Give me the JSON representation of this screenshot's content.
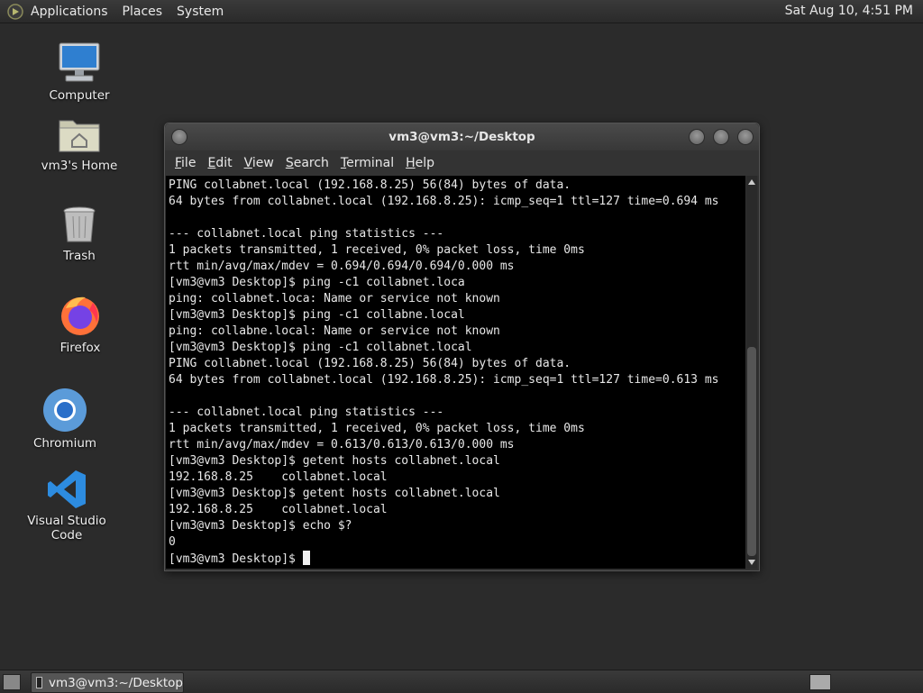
{
  "top_panel": {
    "menus": [
      "Applications",
      "Places",
      "System"
    ],
    "clock": "Sat Aug 10,  4:51 PM"
  },
  "desktop_icons": [
    {
      "label": "Computer",
      "icon": "computer-icon"
    },
    {
      "label": "vm3's Home",
      "icon": "home-folder-icon"
    },
    {
      "label": "Trash",
      "icon": "trash-icon"
    },
    {
      "label": "Firefox",
      "icon": "firefox-icon"
    },
    {
      "label": "Chromium",
      "icon": "chromium-icon"
    },
    {
      "label": "Visual Studio Code",
      "icon": "vscode-icon"
    }
  ],
  "terminal": {
    "title": "vm3@vm3:~/Desktop",
    "menu": [
      "File",
      "Edit",
      "View",
      "Search",
      "Terminal",
      "Help"
    ],
    "lines": [
      "PING collabnet.local (192.168.8.25) 56(84) bytes of data.",
      "64 bytes from collabnet.local (192.168.8.25): icmp_seq=1 ttl=127 time=0.694 ms",
      "",
      "--- collabnet.local ping statistics ---",
      "1 packets transmitted, 1 received, 0% packet loss, time 0ms",
      "rtt min/avg/max/mdev = 0.694/0.694/0.694/0.000 ms",
      "[vm3@vm3 Desktop]$ ping -c1 collabnet.loca",
      "ping: collabnet.loca: Name or service not known",
      "[vm3@vm3 Desktop]$ ping -c1 collabne.local",
      "ping: collabne.local: Name or service not known",
      "[vm3@vm3 Desktop]$ ping -c1 collabnet.local",
      "PING collabnet.local (192.168.8.25) 56(84) bytes of data.",
      "64 bytes from collabnet.local (192.168.8.25): icmp_seq=1 ttl=127 time=0.613 ms",
      "",
      "--- collabnet.local ping statistics ---",
      "1 packets transmitted, 1 received, 0% packet loss, time 0ms",
      "rtt min/avg/max/mdev = 0.613/0.613/0.613/0.000 ms",
      "[vm3@vm3 Desktop]$ getent hosts collabnet.local",
      "192.168.8.25    collabnet.local",
      "[vm3@vm3 Desktop]$ getent hosts collabnet.local",
      "192.168.8.25    collabnet.local",
      "[vm3@vm3 Desktop]$ echo $?",
      "0"
    ],
    "prompt": "[vm3@vm3 Desktop]$ "
  },
  "taskbar": {
    "window_button": "vm3@vm3:~/Desktop"
  }
}
